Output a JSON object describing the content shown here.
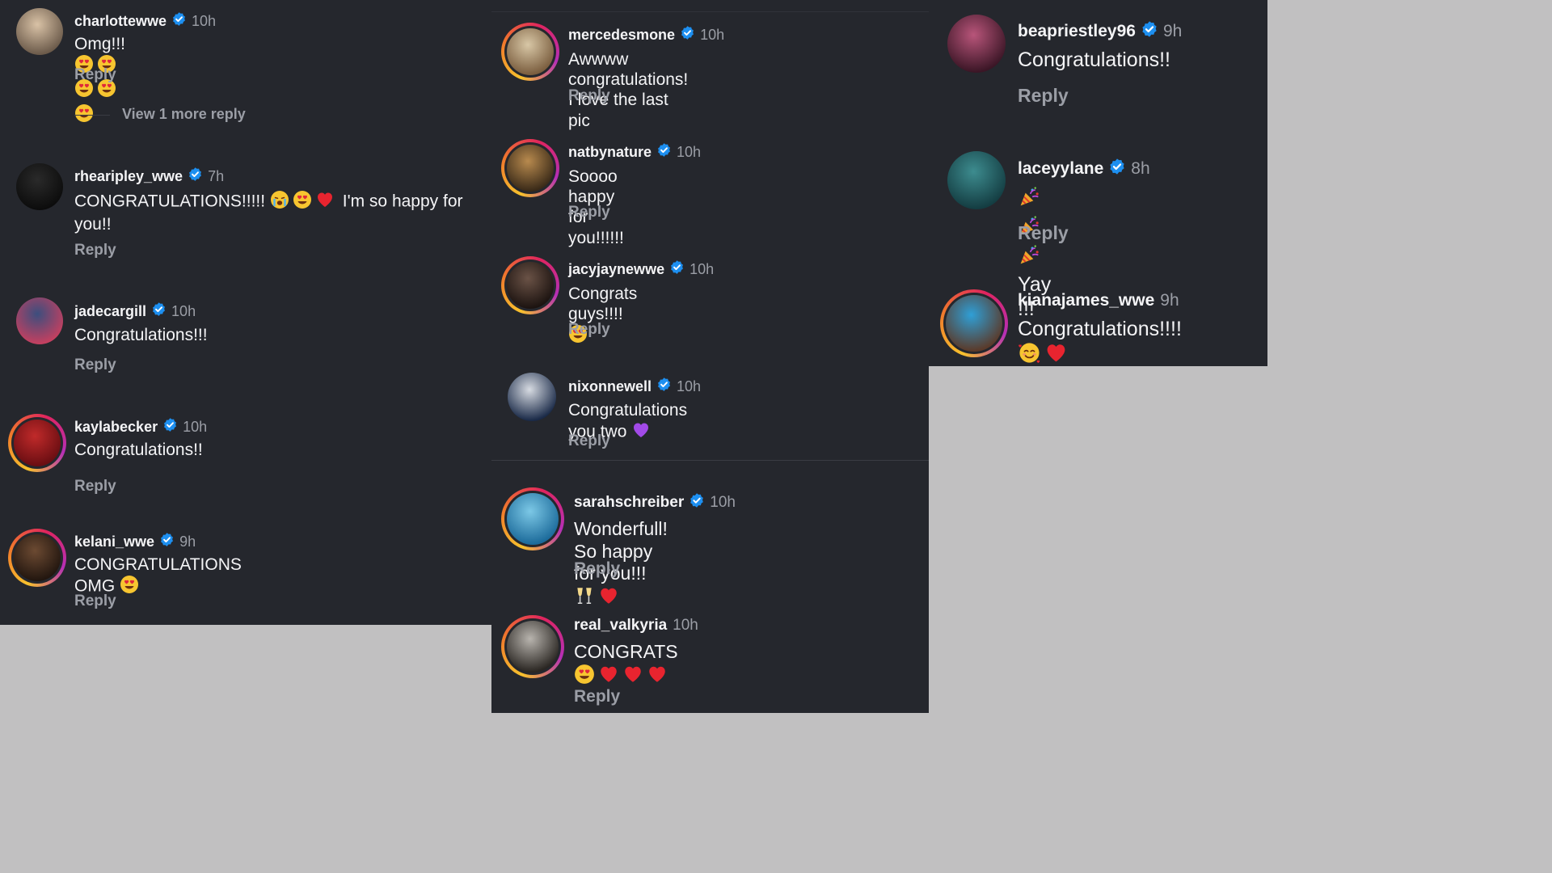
{
  "colors": {
    "panel": "#25272d",
    "background": "#c1c0c1",
    "muted": "#9b9ea6",
    "verified": "#1d8ff0",
    "text": "#f4f4f6"
  },
  "reply_label": "Reply",
  "view_more_label": "View 1 more reply",
  "comments": [
    {
      "username": "charlottewwe",
      "time": "10h",
      "text": "Omg!!!",
      "emoji": [
        "heart-eyes",
        "heart-eyes",
        "heart-eyes",
        "heart-eyes",
        "heart-eyes"
      ],
      "verified": true
    },
    {
      "username": "rhearipley_wwe",
      "time": "7h",
      "text": "CONGRATULATIONS!!!!!",
      "emoji": [
        "crying",
        "heart-eyes",
        "red-heart"
      ],
      "text_after": "I'm so happy for",
      "text_line2": "you!!",
      "verified": true
    },
    {
      "username": "jadecargill",
      "time": "10h",
      "text": "Congratulations!!!",
      "emoji": [],
      "verified": true
    },
    {
      "username": "kaylabecker",
      "time": "10h",
      "text": "Congratulations!!",
      "emoji": [],
      "verified": true
    },
    {
      "username": "kelani_wwe",
      "time": "9h",
      "text": "CONGRATULATIONS OMG",
      "emoji": [
        "heart-eyes"
      ],
      "verified": true
    },
    {
      "username": "mercedesmone",
      "time": "10h",
      "text": "Awwww congratulations! I love the last pic",
      "emoji": [],
      "verified": true
    },
    {
      "username": "natbynature",
      "time": "10h",
      "text": "Soooo happy for you!!!!!!",
      "emoji": [],
      "verified": true
    },
    {
      "username": "jacyjaynewwe",
      "time": "10h",
      "text": "Congrats guys!!!!",
      "emoji": [
        "heart-eyes"
      ],
      "verified": true
    },
    {
      "username": "nixonnewell",
      "time": "10h",
      "text": "Congratulations you two",
      "emoji": [
        "purple-heart"
      ],
      "verified": true
    },
    {
      "username": "sarahschreiber",
      "time": "10h",
      "text": "Wonderfull! So happy for you!!!",
      "emoji": [
        "champagne",
        "red-heart"
      ],
      "verified": true
    },
    {
      "username": "real_valkyria",
      "time": "10h",
      "text": "CONGRATS",
      "emoji": [
        "heart-eyes",
        "red-heart",
        "red-heart",
        "red-heart"
      ],
      "verified": false
    },
    {
      "username": "beapriestley96",
      "time": "9h",
      "text": "Congratulations!!",
      "emoji": [],
      "verified": true
    },
    {
      "username": "laceyylane",
      "time": "8h",
      "text": "Yay !!!",
      "emoji_before": [
        "party-popper",
        "party-popper",
        "party-popper"
      ],
      "emoji": [],
      "verified": true
    },
    {
      "username": "kianajames_wwe",
      "time": "9h",
      "text": "Congratulations!!!!",
      "emoji": [
        "smiling-hearts",
        "red-heart"
      ],
      "verified": false
    }
  ]
}
